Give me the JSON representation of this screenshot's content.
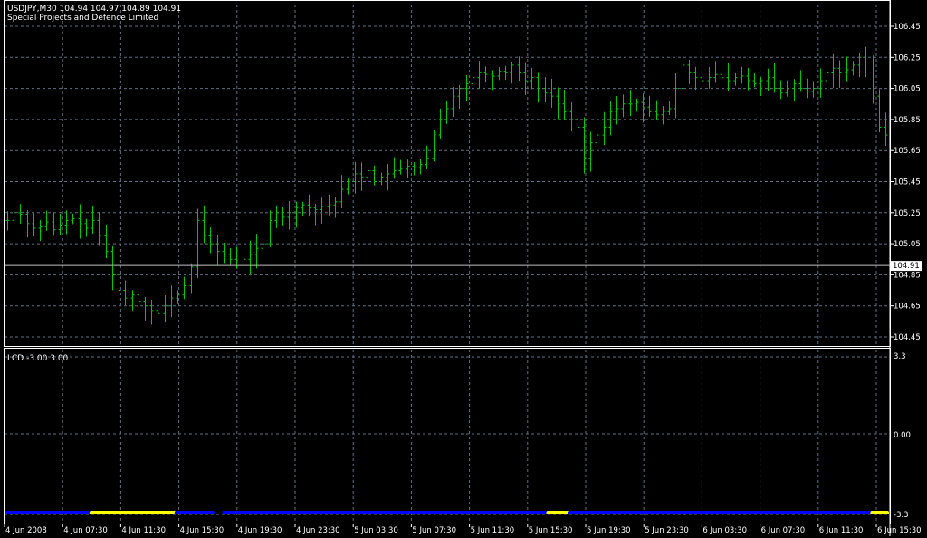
{
  "main_panel": {
    "symbol_info": "USDJPY,M30  104.94 104.97 104.89 104.91",
    "publisher": "Special Projects and Defence Limited",
    "price_marker": "104.91"
  },
  "indicator_panel": {
    "label": "LCD -3.00 3.00",
    "top_level": "3.3",
    "zero_level": "0.00",
    "bottom_level": "-3.3"
  },
  "colors": {
    "background": "#000000",
    "grid": "#5f6f84",
    "bars": "#00c800",
    "frame": "#ffffff",
    "positive": "#ffff00",
    "negative": "#0000ff"
  },
  "chart_data": {
    "type": "ohlc",
    "symbol": "USDJPY",
    "timeframe": "M30",
    "ylim": [
      104.38,
      106.48
    ],
    "y_ticks": [
      "106.45",
      "106.25",
      "106.05",
      "105.85",
      "105.65",
      "105.45",
      "105.25",
      "105.05",
      "104.85",
      "104.65",
      "104.45"
    ],
    "x_ticks": [
      "4 Jun 2008",
      "4 Jun 07:30",
      "4 Jun 11:30",
      "4 Jun 15:30",
      "4 Jun 19:30",
      "4 Jun 23:30",
      "5 Jun 03:30",
      "5 Jun 07:30",
      "5 Jun 11:30",
      "5 Jun 15:30",
      "5 Jun 19:30",
      "5 Jun 23:30",
      "6 Jun 03:30",
      "6 Jun 07:30",
      "6 Jun 11:30",
      "6 Jun 15:30"
    ],
    "last_price": 104.91,
    "close_sequence": [
      105.2,
      105.25,
      105.24,
      105.18,
      105.15,
      105.16,
      105.19,
      105.14,
      105.17,
      105.2,
      105.21,
      105.18,
      105.15,
      105.2,
      105.1,
      105.0,
      104.85,
      104.75,
      104.7,
      104.72,
      104.68,
      104.65,
      104.62,
      104.6,
      104.65,
      104.7,
      104.72,
      104.78,
      104.9,
      105.2,
      105.1,
      105.05,
      105.0,
      104.98,
      104.95,
      104.92,
      104.95,
      104.98,
      105.02,
      105.05,
      105.2,
      105.25,
      105.22,
      105.25,
      105.28,
      105.3,
      105.28,
      105.27,
      105.29,
      105.3,
      105.32,
      105.4,
      105.45,
      105.5,
      105.48,
      105.52,
      105.45,
      105.48,
      105.5,
      105.52,
      105.53,
      105.55,
      105.54,
      105.56,
      105.6,
      105.75,
      105.85,
      105.92,
      106.0,
      106.05,
      106.08,
      106.12,
      106.15,
      106.14,
      106.13,
      106.16,
      106.15,
      106.2,
      106.15,
      106.1,
      106.12,
      106.05,
      106.02,
      106.0,
      105.95,
      105.9,
      105.85,
      105.8,
      105.6,
      105.7,
      105.75,
      105.8,
      105.9,
      105.92,
      105.95,
      105.95,
      105.96,
      105.93,
      105.9,
      105.88,
      105.9,
      105.92,
      106.05,
      106.2,
      106.15,
      106.12,
      106.1,
      106.12,
      106.14,
      106.12,
      106.1,
      106.12,
      106.13,
      106.1,
      106.08,
      106.1,
      106.12,
      106.05,
      106.02,
      106.05,
      106.08,
      106.05,
      106.03,
      106.05,
      106.1,
      106.15,
      106.18,
      106.15,
      106.17,
      106.2,
      106.25,
      106.22,
      106.0,
      105.8,
      105.75
    ],
    "indicator": {
      "name": "LCD",
      "ylim": [
        -3.3,
        3.3
      ],
      "states": [
        "neg",
        "neg",
        "neg",
        "neg",
        "neg",
        "neg",
        "neg",
        "neg",
        "neg",
        "neg",
        "neg",
        "neg",
        "neg",
        "neg",
        "neg",
        "neg",
        "pos",
        "pos",
        "pos",
        "pos",
        "pos",
        "pos",
        "pos",
        "pos",
        "pos",
        "pos",
        "pos",
        "pos",
        "pos",
        "pos",
        "pos",
        "pos",
        "neg",
        "neg",
        "neg",
        "neg",
        "neg",
        "neg",
        "neg",
        "none",
        "none",
        "neg",
        "neg",
        "neg",
        "neg",
        "neg",
        "neg",
        "neg",
        "neg",
        "neg",
        "neg",
        "neg",
        "neg",
        "neg",
        "neg",
        "neg",
        "neg",
        "neg",
        "neg",
        "neg",
        "neg",
        "neg",
        "neg",
        "neg",
        "neg",
        "neg",
        "neg",
        "neg",
        "neg",
        "neg",
        "neg",
        "neg",
        "neg",
        "neg",
        "neg",
        "neg",
        "neg",
        "neg",
        "neg",
        "neg",
        "neg",
        "neg",
        "neg",
        "neg",
        "neg",
        "neg",
        "neg",
        "neg",
        "neg",
        "neg",
        "neg",
        "neg",
        "neg",
        "neg",
        "neg",
        "neg",
        "neg",
        "neg",
        "neg",
        "neg",
        "neg",
        "neg",
        "pos",
        "pos",
        "pos",
        "pos",
        "neg",
        "neg",
        "neg",
        "neg",
        "neg",
        "neg",
        "neg",
        "neg",
        "neg",
        "neg",
        "neg",
        "neg",
        "neg",
        "neg",
        "neg",
        "neg",
        "neg",
        "neg",
        "neg",
        "neg",
        "neg",
        "neg",
        "neg",
        "neg",
        "neg",
        "neg",
        "neg",
        "neg",
        "neg",
        "neg",
        "neg",
        "neg",
        "neg",
        "neg",
        "neg",
        "neg",
        "neg",
        "neg",
        "neg",
        "neg",
        "neg",
        "neg",
        "neg",
        "neg",
        "neg",
        "neg",
        "neg",
        "neg",
        "neg",
        "neg",
        "neg",
        "neg",
        "neg",
        "neg",
        "neg",
        "neg",
        "neg",
        "pos",
        "pos",
        "pos"
      ]
    }
  }
}
